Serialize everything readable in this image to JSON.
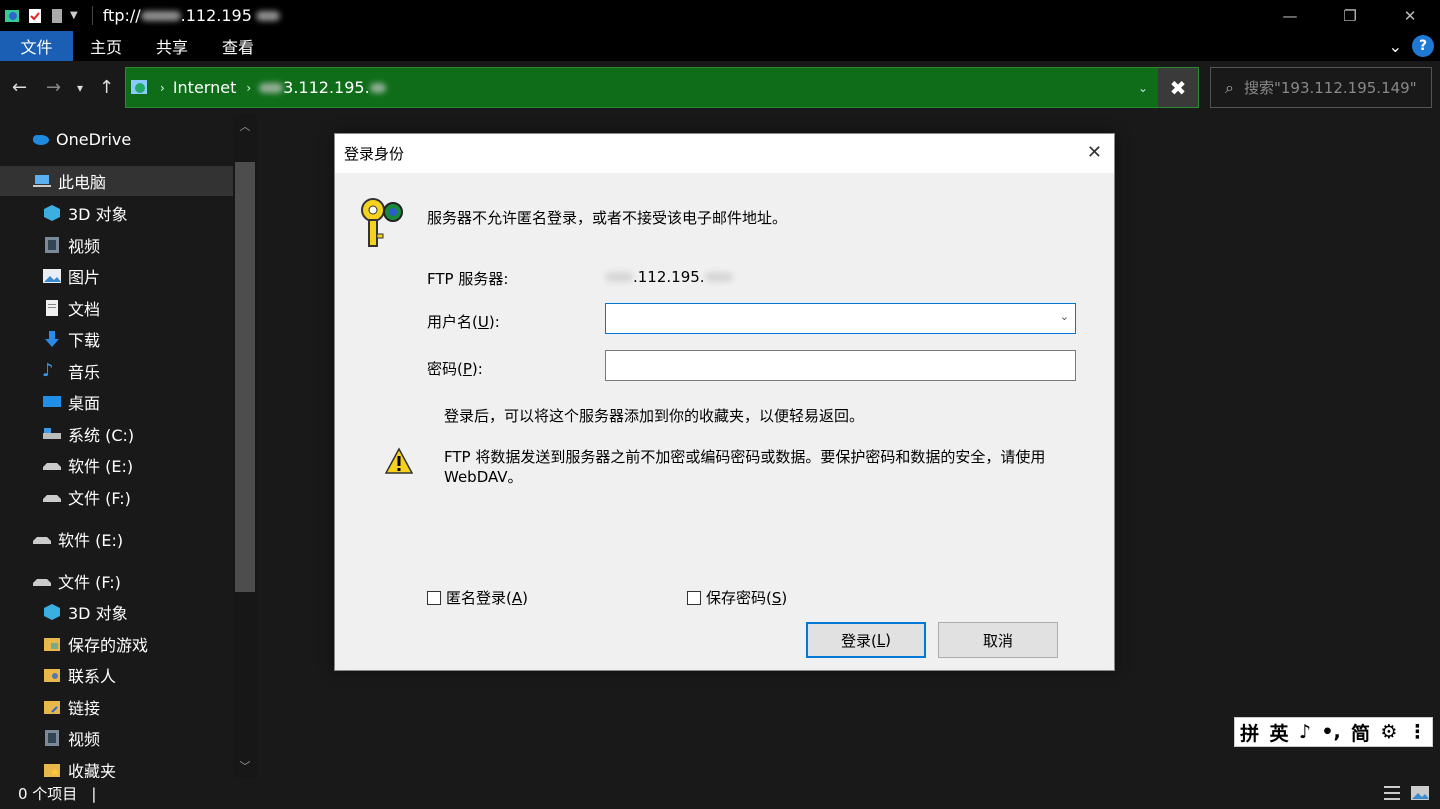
{
  "window": {
    "title": "ftp://",
    "title_tail": ".112.195",
    "minimize": "—",
    "maximize": "❐",
    "close": "✕"
  },
  "ribbon": {
    "tabs": [
      "文件",
      "主页",
      "共享",
      "查看"
    ],
    "help": "?"
  },
  "address": {
    "crumb_root": "Internet",
    "crumb_host": "3.112.195."
  },
  "search": {
    "placeholder": "搜索\"193.112.195.149\""
  },
  "sidebar": {
    "onedrive": "OneDrive",
    "this_pc": "此电脑",
    "items": [
      "3D 对象",
      "视频",
      "图片",
      "文档",
      "下载",
      "音乐",
      "桌面",
      "系统 (C:)",
      "软件 (E:)",
      "文件 (F:)"
    ],
    "drive_e": "软件 (E:)",
    "drive_f": "文件 (F:)",
    "f_items": [
      "3D 对象",
      "保存的游戏",
      "联系人",
      "链接",
      "视频",
      "收藏夹"
    ]
  },
  "status": {
    "count": "0 个项目"
  },
  "dialog": {
    "title": "登录身份",
    "message": "服务器不允许匿名登录，或者不接受该电子邮件地址。",
    "server_label": "FTP 服务器:",
    "server_value": ".112.195.",
    "username_label": "用户名(",
    "username_key": "U",
    "username_tail": "):",
    "password_label": "密码(",
    "password_key": "P",
    "password_tail": "):",
    "info": "登录后，可以将这个服务器添加到你的收藏夹，以便轻易返回。",
    "warning_line1": "FTP 将数据发送到服务器之前不加密或编码密码或数据。要保护密码和数据的安全，请使用",
    "warning_line2": "WebDAV。",
    "anon_label": "匿名登录(",
    "anon_key": "A",
    "save_label": "保存密码(",
    "save_key": "S",
    "login_btn": "登录(",
    "login_key": "L",
    "cancel_btn": "取消",
    "close_paren": ")"
  },
  "ime": {
    "items": [
      "拼",
      "英",
      "♪",
      "•,",
      "简",
      "⚙",
      "⋮"
    ]
  },
  "colors": {
    "address_bg": "#0f6d19",
    "accent": "#0078d7",
    "file_tab": "#1a5fb4"
  }
}
